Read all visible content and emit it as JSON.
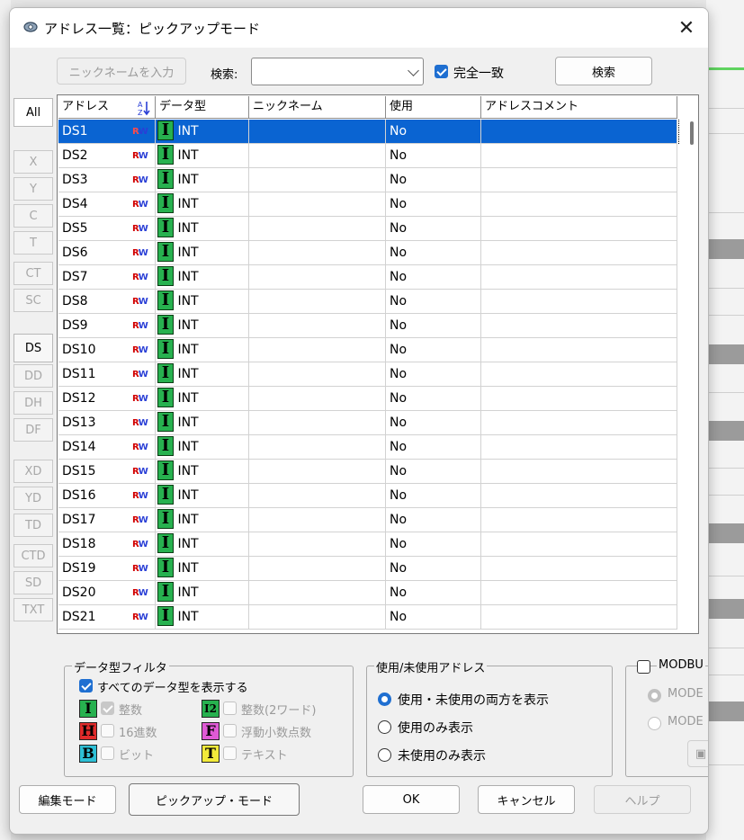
{
  "window": {
    "title": "アドレス一覧：ピックアップモード",
    "close_icon": "close-icon"
  },
  "toolbar": {
    "nickname_button": "ニックネームを入力",
    "search_label": "検索:",
    "search_value": "",
    "exact_match_label": "完全一致",
    "exact_match_checked": true,
    "search_button": "検索"
  },
  "side_tabs": [
    "All",
    "X",
    "Y",
    "C",
    "T",
    "CT",
    "SC",
    "DS",
    "DD",
    "DH",
    "DF",
    "XD",
    "YD",
    "TD",
    "CTD",
    "SD",
    "TXT"
  ],
  "grid": {
    "headers": [
      "アドレス",
      "データ型",
      "ニックネーム",
      "使用",
      "アドレスコメント"
    ],
    "rw_label": "RW",
    "rows": [
      {
        "address": "DS1",
        "type": "INT",
        "nickname": "",
        "used": "No",
        "comment": ""
      },
      {
        "address": "DS2",
        "type": "INT",
        "nickname": "",
        "used": "No",
        "comment": ""
      },
      {
        "address": "DS3",
        "type": "INT",
        "nickname": "",
        "used": "No",
        "comment": ""
      },
      {
        "address": "DS4",
        "type": "INT",
        "nickname": "",
        "used": "No",
        "comment": ""
      },
      {
        "address": "DS5",
        "type": "INT",
        "nickname": "",
        "used": "No",
        "comment": ""
      },
      {
        "address": "DS6",
        "type": "INT",
        "nickname": "",
        "used": "No",
        "comment": ""
      },
      {
        "address": "DS7",
        "type": "INT",
        "nickname": "",
        "used": "No",
        "comment": ""
      },
      {
        "address": "DS8",
        "type": "INT",
        "nickname": "",
        "used": "No",
        "comment": ""
      },
      {
        "address": "DS9",
        "type": "INT",
        "nickname": "",
        "used": "No",
        "comment": ""
      },
      {
        "address": "DS10",
        "type": "INT",
        "nickname": "",
        "used": "No",
        "comment": ""
      },
      {
        "address": "DS11",
        "type": "INT",
        "nickname": "",
        "used": "No",
        "comment": ""
      },
      {
        "address": "DS12",
        "type": "INT",
        "nickname": "",
        "used": "No",
        "comment": ""
      },
      {
        "address": "DS13",
        "type": "INT",
        "nickname": "",
        "used": "No",
        "comment": ""
      },
      {
        "address": "DS14",
        "type": "INT",
        "nickname": "",
        "used": "No",
        "comment": ""
      },
      {
        "address": "DS15",
        "type": "INT",
        "nickname": "",
        "used": "No",
        "comment": ""
      },
      {
        "address": "DS16",
        "type": "INT",
        "nickname": "",
        "used": "No",
        "comment": ""
      },
      {
        "address": "DS17",
        "type": "INT",
        "nickname": "",
        "used": "No",
        "comment": ""
      },
      {
        "address": "DS18",
        "type": "INT",
        "nickname": "",
        "used": "No",
        "comment": ""
      },
      {
        "address": "DS19",
        "type": "INT",
        "nickname": "",
        "used": "No",
        "comment": ""
      },
      {
        "address": "DS20",
        "type": "INT",
        "nickname": "",
        "used": "No",
        "comment": ""
      },
      {
        "address": "DS21",
        "type": "INT",
        "nickname": "",
        "used": "No",
        "comment": ""
      }
    ]
  },
  "type_filter": {
    "title": "データ型フィルタ",
    "show_all_label": "すべてのデータ型を表示する",
    "items": [
      {
        "icon": "I",
        "label": "整数"
      },
      {
        "icon": "I2",
        "label": "整数(2ワード)"
      },
      {
        "icon": "H",
        "label": "16進数"
      },
      {
        "icon": "F",
        "label": "浮動小数点数"
      },
      {
        "icon": "B",
        "label": "ビット"
      },
      {
        "icon": "T",
        "label": "テキスト"
      }
    ]
  },
  "usage_filter": {
    "title": "使用/未使用アドレス",
    "options": [
      "使用・未使用の両方を表示",
      "使用のみ表示",
      "未使用のみ表示"
    ],
    "selected": 0
  },
  "modbus": {
    "label": "MODBU",
    "opt1": "MODE",
    "opt2": "MODE"
  },
  "footer": {
    "edit_mode": "編集モード",
    "pickup_mode": "ピックアップ・モード",
    "ok": "OK",
    "cancel": "キャンセル",
    "help": "ヘルプ"
  },
  "colors": {
    "selection": "#0a64d2",
    "accent": "#1f6fd1"
  }
}
